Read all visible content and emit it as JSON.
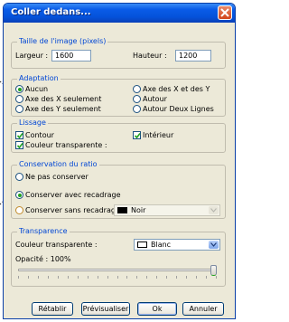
{
  "window": {
    "title": "Coller dedans..."
  },
  "image_size": {
    "legend": "Taille de l'image (pixels)",
    "width_label": "Largeur :",
    "width_value": "1600",
    "height_label": "Hauteur :",
    "height_value": "1200"
  },
  "adaptation": {
    "legend": "Adaptation",
    "options": [
      "Aucun",
      "Axe des X et des Y",
      "Axe des X seulement",
      "Autour",
      "Axe des Y seulement",
      "Autour Deux Lignes"
    ],
    "selected": "Aucun"
  },
  "smoothing": {
    "legend": "Lissage",
    "contour": "Contour",
    "interior": "Intérieur",
    "transparent_color": "Couleur transparente :"
  },
  "ratio": {
    "legend": "Conservation du ratio",
    "no_keep": "Ne pas conserver",
    "keep_crop": "Conserver avec recadrage",
    "keep_no_crop": "Conserver sans recadrage",
    "fill_color_value": "Noir",
    "selected": "Conserver avec recadrage"
  },
  "transparency": {
    "legend": "Transparence",
    "color_label": "Couleur transparente :",
    "color_value": "Blanc",
    "opacity_label": "Opacité : 100%",
    "opacity_fraction": 1.0
  },
  "buttons": {
    "reset": "Rétablir",
    "preview": "Prévisualiser",
    "ok": "Ok",
    "cancel": "Annuler"
  },
  "colors": {
    "titlebar": "#0a5ce8",
    "legend_text": "#0046d5",
    "window_bg": "#ece9d8",
    "radio_dot": "#21a121"
  }
}
